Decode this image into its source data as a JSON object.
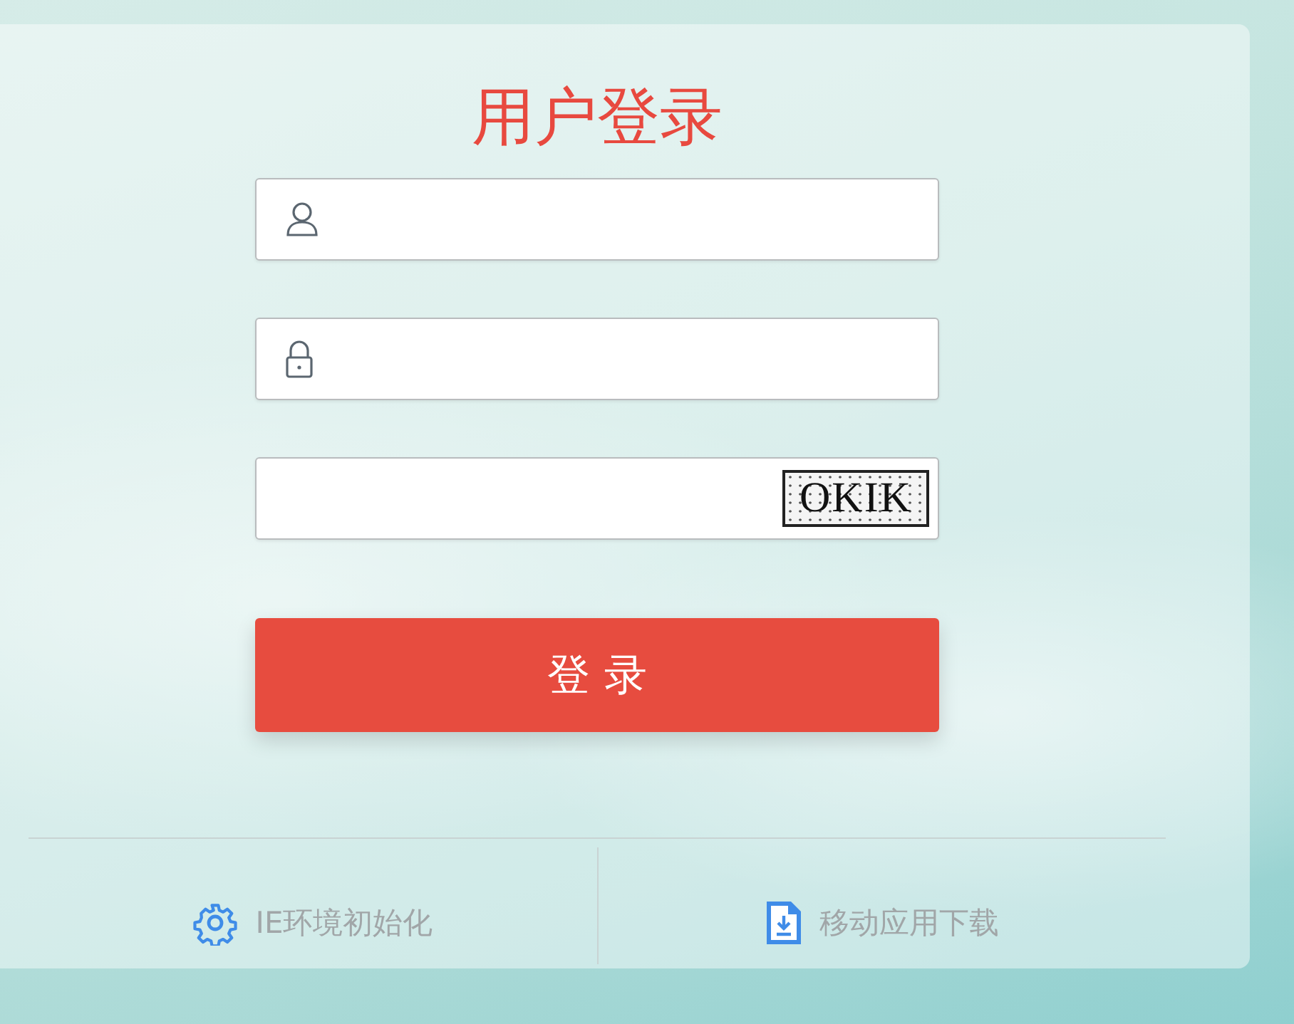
{
  "title": "用户登录",
  "fields": [
    {
      "kind": "username"
    },
    {
      "kind": "password"
    },
    {
      "kind": "captcha",
      "captcha": "OKIK"
    }
  ],
  "login_button": "登 录",
  "footer_links": [
    {
      "kind": "settings",
      "label": "IE环境初始化"
    },
    {
      "kind": "download",
      "label": "移动应用下载"
    }
  ]
}
